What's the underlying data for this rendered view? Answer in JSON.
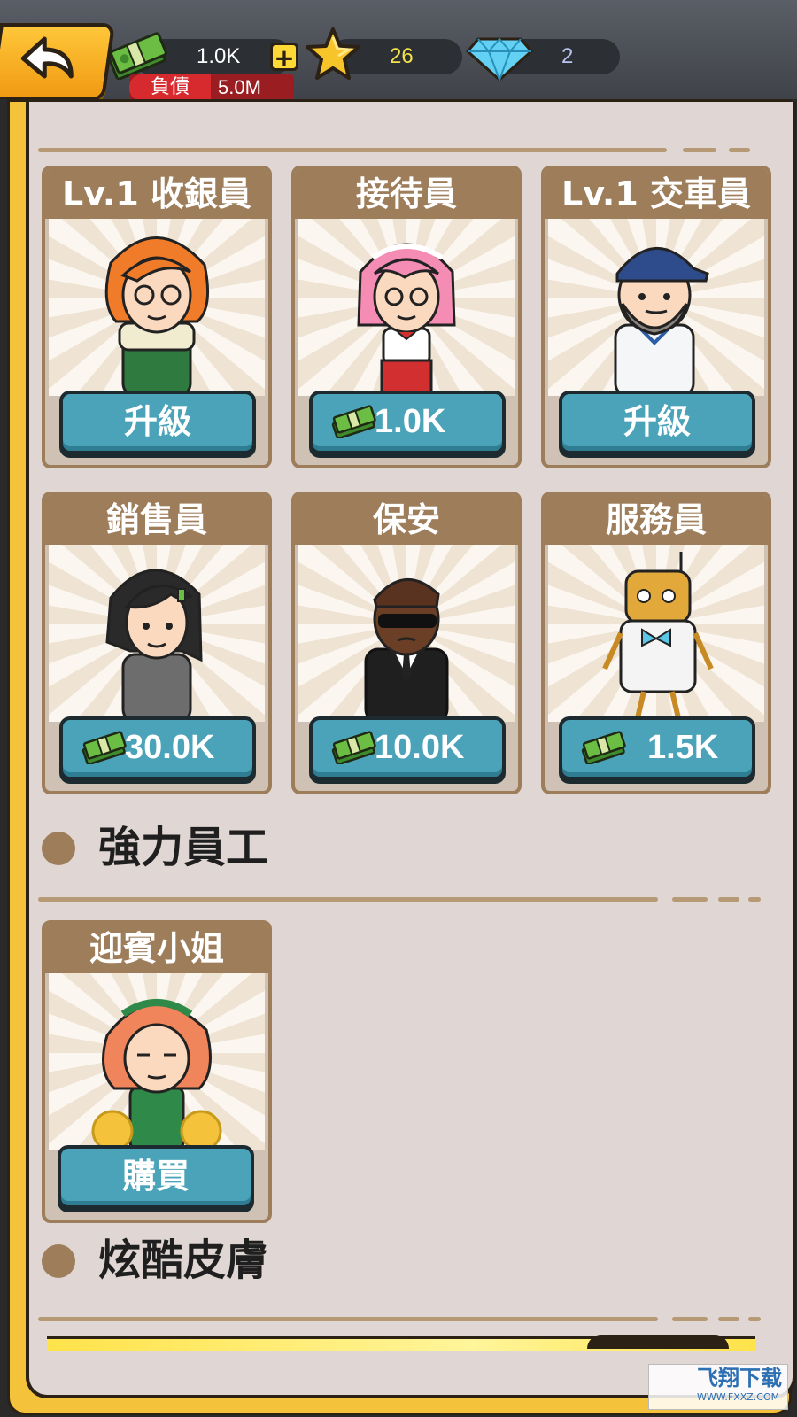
{
  "currency": {
    "cash": "1.0K",
    "stars": "26",
    "gems": "2",
    "debt_label": "負債",
    "debt_value": "5.0M"
  },
  "staff_cards": [
    {
      "title": "Lv.1 收銀員",
      "button": "升級"
    },
    {
      "title": "接待員",
      "button": "1.0K"
    },
    {
      "title": "Lv.1 交車員",
      "button": "升級"
    },
    {
      "title": "銷售員",
      "button": "30.0K"
    },
    {
      "title": "保安",
      "button": "10.0K"
    },
    {
      "title": "服務員",
      "button": "1.5K"
    }
  ],
  "sections": {
    "powerful_staff": "強力員工",
    "cool_skins": "炫酷皮膚"
  },
  "power_cards": [
    {
      "title": "迎賓小姐",
      "button": "購買"
    }
  ],
  "watermark": {
    "brand": "飞翔下载",
    "url": "WWW.FXXZ.COM"
  },
  "colors": {
    "button": "#4aa3b8",
    "card_header": "#9e7d5a",
    "panel_bg": "#e0d6d3",
    "debt_red": "#d72a2f",
    "accent_gold": "#f5c33b"
  }
}
